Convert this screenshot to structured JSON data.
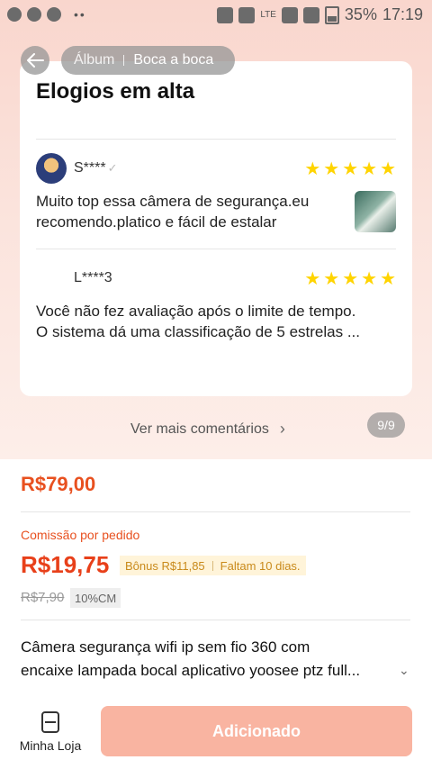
{
  "status_bar": {
    "battery": "35%",
    "time": "17:19",
    "network": "LTE"
  },
  "header": {
    "tabs": [
      {
        "label": "Álbum",
        "active": false
      },
      {
        "label": "Boca a boca",
        "active": true
      }
    ]
  },
  "reviews": {
    "title": "Elogios em alta",
    "items": [
      {
        "user": "S****",
        "stars": 5,
        "text_line1": "Muito top essa câmera de segurança.eu",
        "text_line2": "recomendo.platico e fácil de estalar"
      },
      {
        "user": "L****3",
        "stars": 5,
        "text_line1": "Você não fez avaliação após o limite de tempo.",
        "text_line2": "O sistema dá uma classificação de 5 estrelas ..."
      }
    ],
    "more_label": "Ver mais comentários",
    "page_indicator": "9/9"
  },
  "product": {
    "price": "R$79,00",
    "commission_label": "Comissão por pedido",
    "commission_value": "R$19,75",
    "bonus": "Bônus R$11,85",
    "deadline": "Faltam 10 dias.",
    "old_commission": "R$7,90",
    "rate_badge": "10%CM",
    "title_line1": "Câmera segurança wifi ip sem fio 360 com",
    "title_line2": "encaixe lampada bocal aplicativo yoosee ptz full..."
  },
  "bottom_bar": {
    "store_label": "Minha Loja",
    "action_label": "Adicionado"
  },
  "colors": {
    "accent": "#e8501f",
    "button_disabled": "#f9b4a1",
    "star": "#ffd400"
  }
}
